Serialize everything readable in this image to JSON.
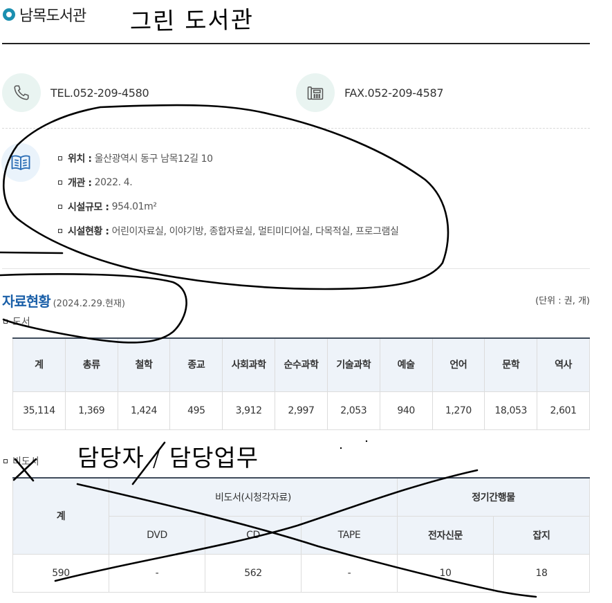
{
  "header": {
    "title": "남목도서관",
    "handwriting": "그린 도서관"
  },
  "contact": {
    "tel": "TEL.052-209-4580",
    "fax": "FAX.052-209-4587"
  },
  "info": [
    {
      "label": "위치 :",
      "value": "울산광역시 동구 남목12길 10"
    },
    {
      "label": "개관 :",
      "value": "2022. 4."
    },
    {
      "label": "시설규모 :",
      "value": "954.01m²"
    },
    {
      "label": "시설현황 :",
      "value": "어린이자료실, 이야기방, 종합자료실, 멀티미디어실, 다목적실, 프로그램실"
    }
  ],
  "collection": {
    "title": "자료현황",
    "date": "(2024.2.29.현재)",
    "unit": "(단위 : 권, 개)",
    "books_label": "도서",
    "books_headers": [
      "계",
      "총류",
      "철학",
      "종교",
      "사회과학",
      "순수과학",
      "기술과학",
      "예술",
      "언어",
      "문학",
      "역사"
    ],
    "books_values": [
      "35,114",
      "1,369",
      "1,424",
      "495",
      "3,912",
      "2,997",
      "2,053",
      "940",
      "1,270",
      "18,053",
      "2,601"
    ],
    "nonbook_label": "비도서",
    "nonbook_handwriting": "담당자 / 담당업무",
    "nonbook_headers": {
      "total": "계",
      "group_av": "비도서(시청각자료)",
      "group_periodical": "정기간행물",
      "dvd": "DVD",
      "cd": "CD",
      "tape": "TAPE",
      "newspaper": "전자신문",
      "magazine": "잡지"
    },
    "nonbook_values": {
      "total": "590",
      "dvd": "-",
      "cd": "562",
      "tape": "-",
      "newspaper": "10",
      "magazine": "18"
    }
  }
}
